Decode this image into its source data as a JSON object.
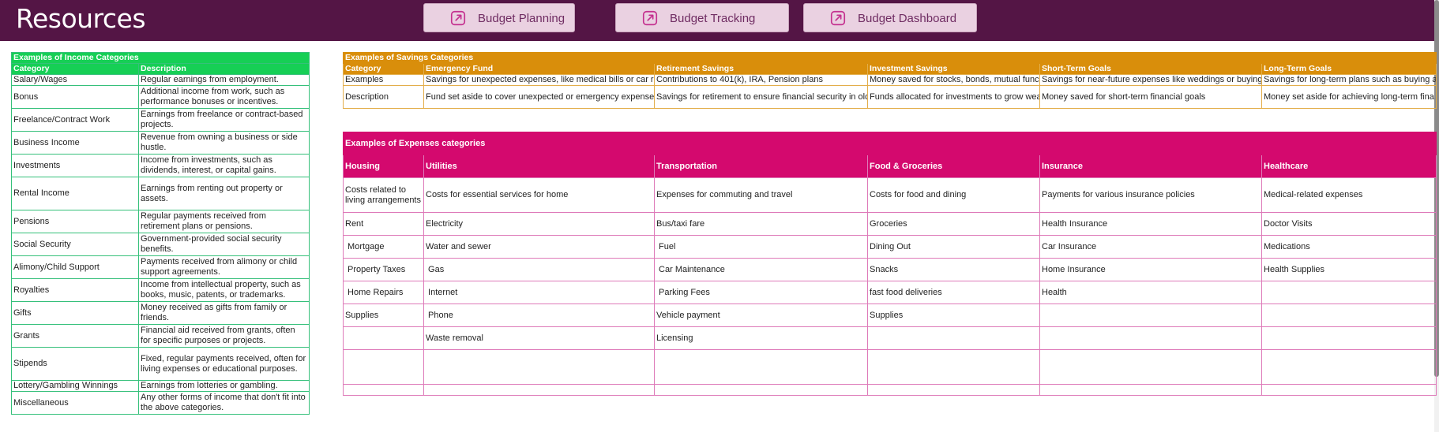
{
  "header": {
    "title": "Resources",
    "buttons": [
      {
        "label": "Budget Planning",
        "icon": "external-link-icon"
      },
      {
        "label": "Budget Tracking",
        "icon": "external-link-icon"
      },
      {
        "label": "Budget Dashboard",
        "icon": "external-link-icon"
      }
    ]
  },
  "colors": {
    "header_bg": "#541545",
    "button_bg": "#ead1e1",
    "income_accent": "#16cf55",
    "savings_accent": "#d98e0b",
    "expenses_accent": "#d4096e"
  },
  "income": {
    "title": "Examples of  Income Categories",
    "headers": [
      "Category",
      "Description"
    ],
    "rows": [
      [
        "Salary/Wages",
        "Regular earnings from employment."
      ],
      [
        "Bonus",
        "Additional income from work, such as performance bonuses or incentives."
      ],
      [
        "Freelance/Contract Work",
        "Earnings from freelance or contract-based projects."
      ],
      [
        "Business Income",
        "Revenue from owning a business or side hustle."
      ],
      [
        "Investments",
        "Income from investments, such as dividends, interest, or capital gains."
      ],
      [
        "Rental Income",
        "Earnings from renting out property or assets."
      ],
      [
        "Pensions",
        "Regular payments received from retirement plans or pensions."
      ],
      [
        "Social Security",
        "Government-provided social security benefits."
      ],
      [
        "Alimony/Child Support",
        "Payments received from alimony or child support agreements."
      ],
      [
        "Royalties",
        "Income from intellectual property, such as books, music, patents, or trademarks."
      ],
      [
        "Gifts",
        "Money received as gifts from family or friends."
      ],
      [
        "Grants",
        "Financial aid received from grants, often for specific purposes or projects."
      ],
      [
        "Stipends",
        "Fixed, regular payments received, often for living expenses or educational purposes."
      ],
      [
        "Lottery/Gambling Winnings",
        "Earnings from lotteries or gambling."
      ],
      [
        "Miscellaneous",
        "Any other forms of income that don't fit into the above categories."
      ]
    ]
  },
  "savings": {
    "title": "Examples of Savings Categories",
    "headers": [
      "Category",
      "Emergency Fund",
      "Retirement Savings",
      "Investment Savings",
      "Short-Term Goals",
      "Long-Term Goals"
    ],
    "rows": [
      [
        "Examples",
        "Savings for unexpected expenses, like medical bills or car r",
        "Contributions to 401(k), IRA, Pension plans",
        "Money saved for stocks, bonds, mutual func",
        "Savings for near-future expenses like weddings or buying",
        "Savings for long-term plans such as buying a"
      ],
      [
        "Description",
        "Fund set aside to cover unexpected or emergency expense",
        "Savings for retirement to ensure financial security in old",
        "Funds allocated for investments to grow wea",
        "Money saved for short-term financial goals",
        "Money set aside for achieving long-term fina"
      ]
    ]
  },
  "expenses": {
    "title": "Examples of Expenses categories",
    "headers": [
      "Housing",
      "Utilities",
      "Transportation",
      "Food & Groceries",
      "Insurance",
      "Healthcare"
    ],
    "rows": [
      [
        "Costs related to living arrangements",
        "Costs for essential services for home",
        "Expenses for commuting and travel",
        "Costs for food and dining",
        "Payments for various insurance policies",
        "Medical-related expenses"
      ],
      [
        "Rent",
        "Electricity",
        "Bus/taxi fare",
        "Groceries",
        "Health Insurance",
        "Doctor Visits"
      ],
      [
        " Mortgage",
        "Water and sewer",
        " Fuel",
        "Dining Out",
        "Car Insurance",
        "Medications"
      ],
      [
        " Property Taxes",
        " Gas",
        " Car Maintenance",
        "Snacks",
        "Home Insurance",
        "Health Supplies"
      ],
      [
        " Home Repairs",
        " Internet",
        " Parking Fees",
        "fast food deliveries",
        "Health",
        ""
      ],
      [
        "Supplies",
        " Phone",
        "Vehicle payment",
        "Supplies",
        "",
        ""
      ],
      [
        "",
        "Waste removal",
        "Licensing",
        "",
        "",
        ""
      ],
      [
        "",
        "",
        "",
        "",
        "",
        ""
      ],
      [
        "",
        "",
        "",
        "",
        "",
        ""
      ]
    ]
  }
}
